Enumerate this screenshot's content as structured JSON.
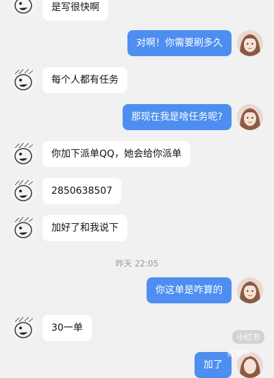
{
  "messages": [
    {
      "side": "in",
      "text": "是写很快啊"
    },
    {
      "side": "out",
      "text": "对啊！你需要刷多久"
    },
    {
      "side": "in",
      "text": "每个人都有任务"
    },
    {
      "side": "out",
      "text": "那现在我是啥任务呢?"
    },
    {
      "side": "in",
      "text": "你加下派单QQ，她会给你派单"
    },
    {
      "side": "in",
      "text": "2850638507"
    },
    {
      "side": "in",
      "text": "加好了和我说下"
    },
    {
      "side": "out",
      "text": "你这单是咋算的"
    },
    {
      "side": "in",
      "text": "30一单"
    },
    {
      "side": "out",
      "text": "加了"
    }
  ],
  "timestamp": "昨天 22:05",
  "watermark": {
    "brand": "小红书",
    "id": "红书号：..."
  },
  "colors": {
    "background": "#f1f1f1",
    "outgoing": "#4e8ef0",
    "incoming": "#ffffff"
  },
  "avatars": {
    "incoming": "cartoon-face-avatar",
    "outgoing": "girl-photo-avatar"
  }
}
